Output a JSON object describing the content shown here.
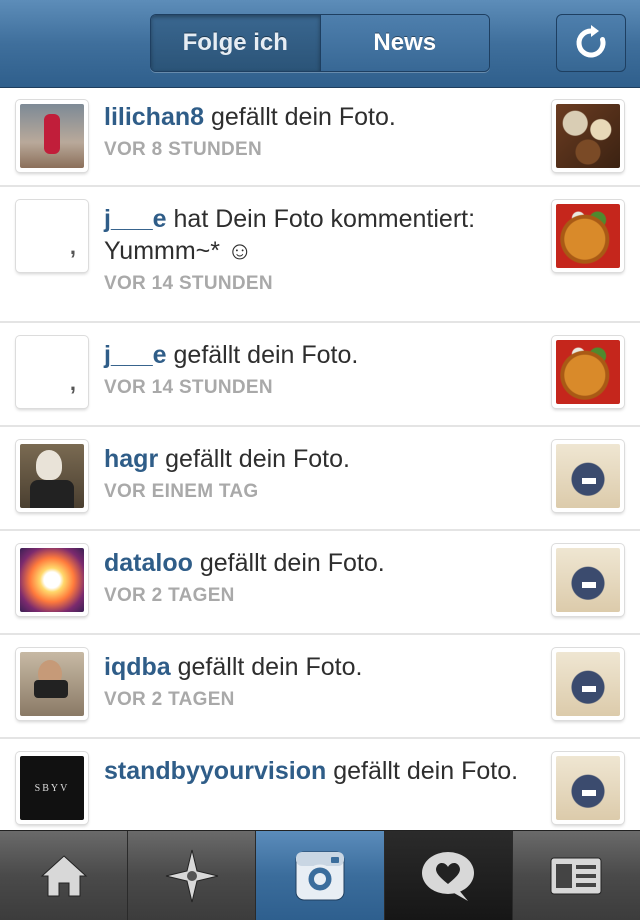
{
  "header": {
    "tabs": [
      {
        "label": "Folge ich"
      },
      {
        "label": "News"
      }
    ]
  },
  "feed": [
    {
      "user": "lilichan8",
      "action": "gefällt dein Foto.",
      "time": "VOR 8 STUNDEN"
    },
    {
      "user": "j___e",
      "action": "hat Dein Foto kommentiert:",
      "comment": "Yummm~* ☺",
      "time": "VOR 14 STUNDEN"
    },
    {
      "user": "j___e",
      "action": "gefällt dein Foto.",
      "time": "VOR 14 STUNDEN"
    },
    {
      "user": "hagr",
      "action": "gefällt dein Foto.",
      "time": "VOR EINEM TAG"
    },
    {
      "user": "dataloo",
      "action": "gefällt dein Foto.",
      "time": "VOR 2 TAGEN"
    },
    {
      "user": "iqdba",
      "action": "gefällt dein Foto.",
      "time": "VOR 2 TAGEN"
    },
    {
      "user": "standbyyourvision",
      "action": "gefällt dein Foto.",
      "avatar_text": "SBYV"
    }
  ],
  "tabbar": [
    {
      "icon": "home-icon"
    },
    {
      "icon": "explore-star-icon"
    },
    {
      "icon": "camera-icon"
    },
    {
      "icon": "news-heart-bubble-icon"
    },
    {
      "icon": "profile-card-icon"
    }
  ],
  "colors": {
    "header": "#3f6f9c",
    "username": "#2f5d88",
    "timestamp": "#a9a9a9",
    "active_tab": "#3b6d9c"
  }
}
